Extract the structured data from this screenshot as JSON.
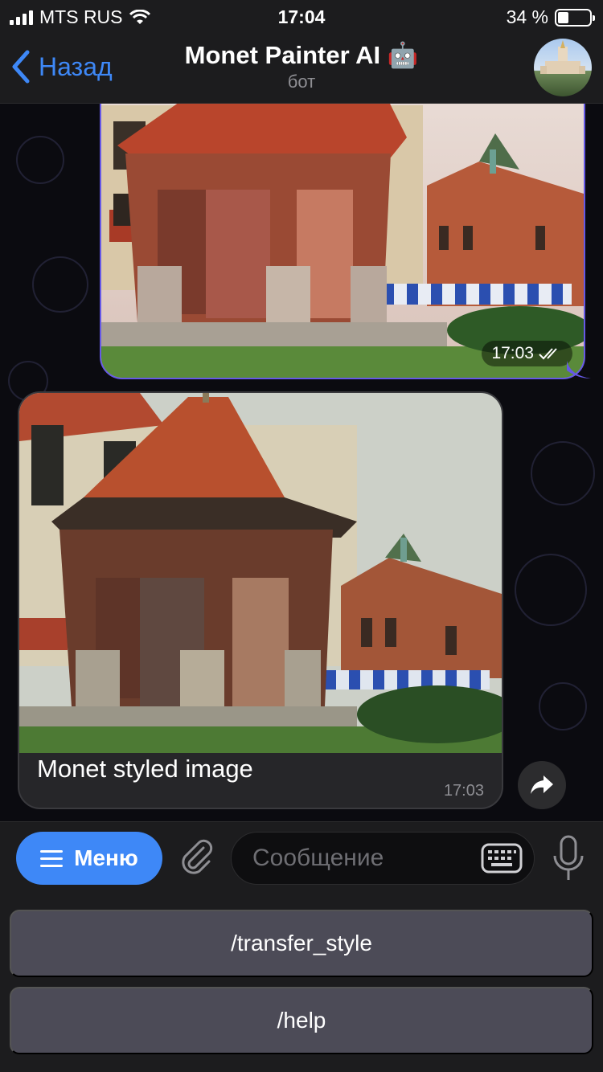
{
  "status_bar": {
    "carrier": "MTS RUS",
    "time": "17:04",
    "battery_text": "34 %",
    "battery_level": 0.34
  },
  "header": {
    "back_label": "Назад",
    "title": "Monet Painter AI 🤖",
    "subtitle": "бот",
    "avatar_icon": "avatar-photo"
  },
  "messages": [
    {
      "direction": "outgoing",
      "type": "photo",
      "time": "17:03",
      "status_icon": "double-check-icon"
    },
    {
      "direction": "incoming",
      "type": "photo",
      "caption": "Monet styled image",
      "time": "17:03"
    }
  ],
  "input_bar": {
    "menu_label": "Меню",
    "placeholder": "Сообщение"
  },
  "keyboard": {
    "buttons": [
      "/transfer_style",
      "/help"
    ]
  },
  "colors": {
    "accent": "#3e88f7",
    "outgoing_bubble": "#6659e6",
    "button_bg": "#4c4b57"
  }
}
